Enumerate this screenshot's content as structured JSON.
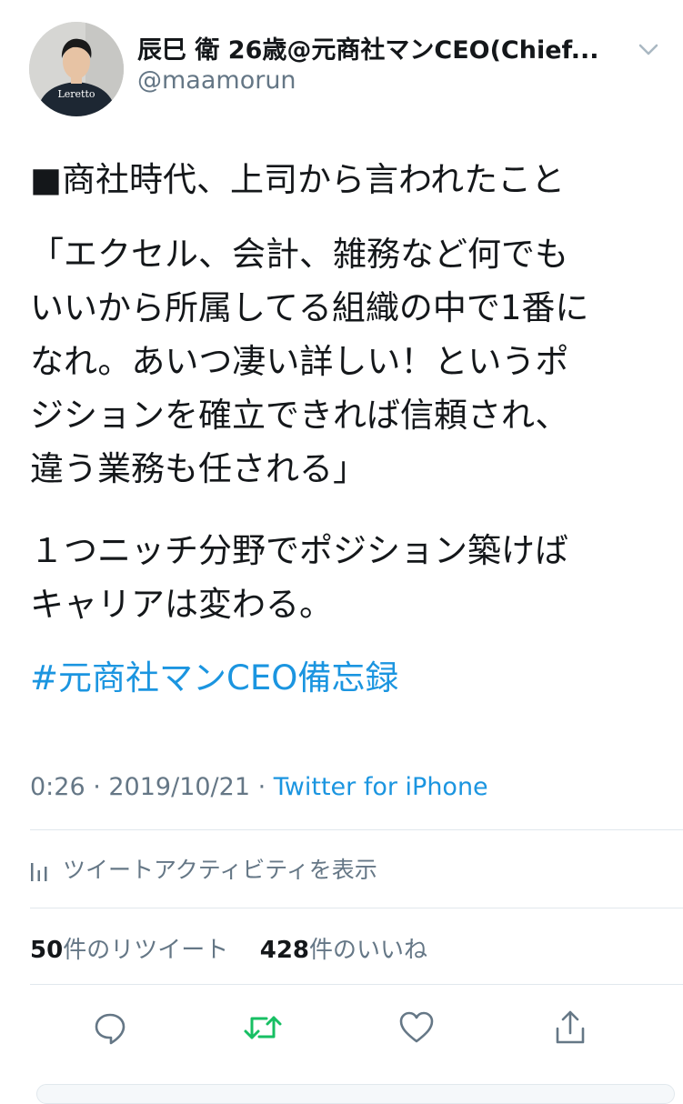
{
  "user": {
    "name": "辰巳 衛 26歳@元商社マンCEO(Chief...",
    "handle": "@maamorun",
    "avatar_shirt_text": "Leretto"
  },
  "tweet": {
    "line1": "■商社時代、上司から言われたこと",
    "line2": "「エクセル、会計、雑務など何でも",
    "line3": "いいから所属してる組織の中で1番に",
    "line4": "なれ。あいつ凄い詳しい！というポ",
    "line5": "ジションを確立できれば信頼され、",
    "line6": "違う業務も任される」",
    "line7": "１つニッチ分野でポジション築けば",
    "line8": "キャリアは変わる。",
    "hashtag": "#元商社マンCEO備忘録"
  },
  "meta": {
    "time_date": "0:26 · 2019/10/21 · ",
    "source": "Twitter for iPhone"
  },
  "activity": {
    "label": "ツイートアクティビティを表示"
  },
  "stats": {
    "retweet_count": "50",
    "retweet_label": "件のリツイート",
    "like_count": "428",
    "like_label": "件のいいね"
  },
  "colors": {
    "link": "#1b95e0",
    "secondary_text": "#657786",
    "retweet_active": "#17bf63",
    "divider": "#e1e8ed"
  },
  "icons": [
    "chevron-down-icon",
    "bar-chart-icon",
    "reply-icon",
    "retweet-icon",
    "like-icon",
    "share-icon"
  ]
}
